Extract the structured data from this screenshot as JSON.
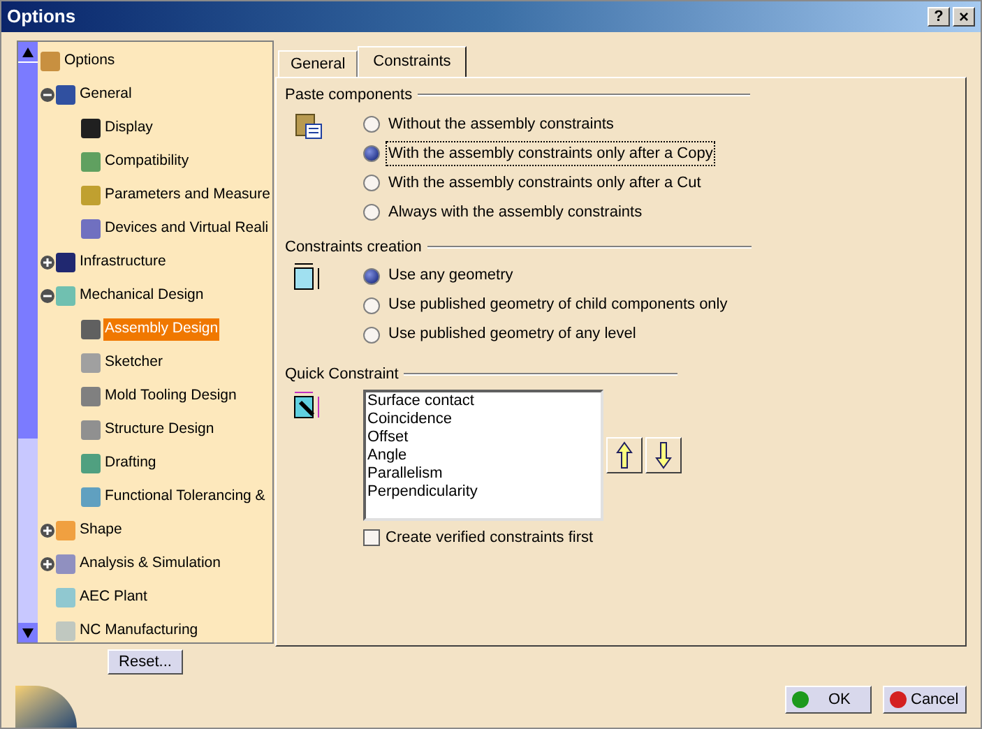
{
  "window": {
    "title": "Options",
    "help_button": "?",
    "close_button": "×"
  },
  "tree": {
    "label": "Options",
    "selected": false,
    "children": [
      {
        "label": "General",
        "expanded": true,
        "selected": false,
        "children": [
          {
            "label": "Display",
            "selected": false
          },
          {
            "label": "Compatibility",
            "selected": false
          },
          {
            "label": "Parameters and Measure",
            "selected": false
          },
          {
            "label": "Devices and Virtual Reali",
            "selected": false
          }
        ]
      },
      {
        "label": "Infrastructure",
        "expanded": false,
        "selected": false
      },
      {
        "label": "Mechanical Design",
        "expanded": true,
        "selected": false,
        "children": [
          {
            "label": "Assembly Design",
            "selected": true
          },
          {
            "label": "Sketcher",
            "selected": false
          },
          {
            "label": "Mold Tooling Design",
            "selected": false
          },
          {
            "label": "Structure Design",
            "selected": false
          },
          {
            "label": "Drafting",
            "selected": false
          },
          {
            "label": "Functional Tolerancing &",
            "selected": false
          }
        ]
      },
      {
        "label": "Shape",
        "expanded": false,
        "selected": false
      },
      {
        "label": "Analysis & Simulation",
        "expanded": false,
        "selected": false
      },
      {
        "label": "AEC Plant",
        "selected": false
      },
      {
        "label": "NC Manufacturing",
        "selected": false
      }
    ]
  },
  "reset_button": "Reset...",
  "tabs": [
    {
      "label": "General",
      "selected": false
    },
    {
      "label": "Constraints",
      "selected": true
    }
  ],
  "paste_components": {
    "title": "Paste components",
    "options": [
      {
        "label": "Without the assembly constraints",
        "selected": false,
        "focused": false
      },
      {
        "label": "With the assembly constraints only after a Copy",
        "selected": true,
        "focused": true
      },
      {
        "label": "With the assembly constraints only after a Cut",
        "selected": false,
        "focused": false
      },
      {
        "label": "Always with the assembly constraints",
        "selected": false,
        "focused": false
      }
    ]
  },
  "constraints_creation": {
    "title": "Constraints creation",
    "options": [
      {
        "label": "Use any geometry",
        "selected": true,
        "focused": false
      },
      {
        "label": "Use published geometry of child components only",
        "selected": false,
        "focused": false
      },
      {
        "label": "Use published geometry of any level",
        "selected": false,
        "focused": false
      }
    ]
  },
  "quick_constraint": {
    "title": "Quick Constraint",
    "items": [
      "Surface contact",
      "Coincidence",
      "Offset",
      "Angle",
      "Parallelism",
      "Perpendicularity"
    ],
    "checkbox": {
      "label": "Create verified constraints first",
      "checked": false
    }
  },
  "buttons": {
    "ok": "OK",
    "cancel": "Cancel"
  }
}
